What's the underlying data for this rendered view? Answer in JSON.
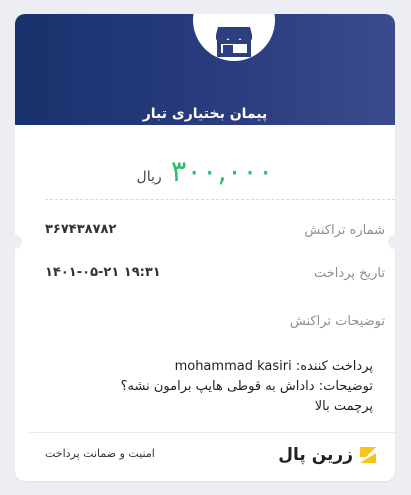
{
  "merchant": {
    "title": "پیمان بختیاری تبار",
    "logo_icon": "storefront-icon"
  },
  "amount": {
    "value": "۳۰۰,۰۰۰",
    "unit": "ریال"
  },
  "details": [
    {
      "label": "شماره تراکنش",
      "value": "۳۶۷۴۳۸۷۸۲"
    },
    {
      "label": "تاریخ پرداخت",
      "value": "۱۴۰۱-۰۵-۲۱ ۱۹:۳۱"
    },
    {
      "label": "توضیحات تراکنش",
      "value": ""
    }
  ],
  "description_lines": [
    "پرداخت کننده: mohammad kasiri",
    "توضیحات: داداش به قوطی هایپ برامون نشه؟",
    "پرچمت بالا"
  ],
  "footer": {
    "security_text": "امنیت و ضمانت پرداخت",
    "brand_name": "زرین پال",
    "brand_icon": "zarinpal-logo-icon"
  },
  "colors": {
    "header": "#18326d",
    "amount": "#2fbd6e",
    "brand_accent": "#f6c51b"
  }
}
